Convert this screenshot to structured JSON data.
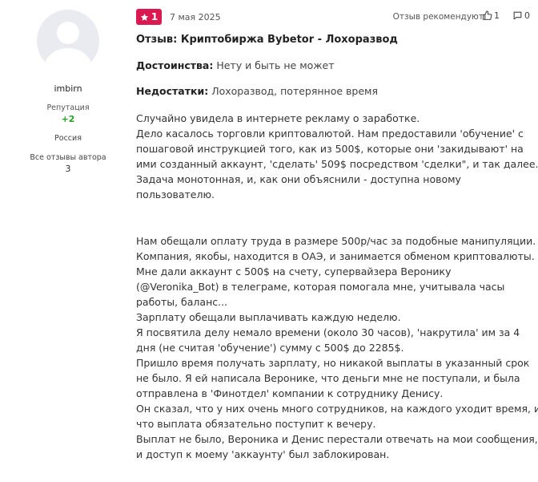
{
  "author": {
    "username": "imbirn",
    "reputation_label": "Репутация",
    "reputation_value": "+2",
    "country": "Россия",
    "all_reviews_label": "Все отзывы автора",
    "reviews_count": "3"
  },
  "review": {
    "rating": "1",
    "date": "7 мая 2025",
    "recommend_label": "Отзыв рекомендуют",
    "likes": "1",
    "comments": "0",
    "title": "Отзыв: Криптобиржа Bybetor - Лохоразвод",
    "pros_label": "Достоинства:",
    "pros_text": "Нету и быть не может",
    "cons_label": "Недостатки:",
    "cons_text": "Лохоразвод, потерянное время",
    "paragraph1": [
      "Случайно увидела в интернете рекламу о заработке.",
      "Дело касалось торговли криптовалютой. Нам предоставили 'обучение' с",
      "пошаговой инструкцией того, как из 500$, которые они 'закидывают' на",
      "ими созданный аккаунт, 'сделать' 509$ посредством 'сделки\", и так далее.",
      "Задача монотонная, и, как они объяснили - доступна новому",
      "пользователю."
    ],
    "paragraph2": [
      "Нам обещали оплату труда в размере 500р/час за подобные манипуляции.",
      "Компания, якобы, находится в ОАЭ, и занимается обменом криптовалюты.",
      "Мне дали аккаунт с 500$ на счету, супервайзера Веронику",
      "(@Veronika_Bot) в телеграме, которая помогала мне, учитывала часы",
      "работы, баланс...",
      "Зарплату обещали выплачивать каждую неделю.",
      "Я посвятила делу немало времени (около 30 часов), 'накрутила' им за 4",
      "дня (не считая 'обучение') сумму с 500$ до 2285$.",
      "Пришло время получать зарплату, но никакой выплаты в указанный срок",
      "не было. Я ей написала Веронике, что деньги мне не поступали, и была",
      "отправлена в 'Финотдел' компании к сотруднику Денису.",
      "Он сказал, что у них очень много сотрудников, на каждого уходит время, и",
      "что выплата обязательно поступит к вечеру.",
      "Выплат не было, Вероника и Денис перестали отвечать на мои сообщения,",
      "и доступ к моему 'аккаунту' был заблокирован."
    ]
  },
  "colors": {
    "rating_badge": "#d9194f",
    "reputation_positive": "#2aa02a",
    "avatar_bg": "#e9ebf0"
  },
  "icons": {
    "rating": "star-icon",
    "like": "thumbs-up-icon",
    "comment": "comment-icon",
    "avatar": "default-avatar-icon"
  }
}
